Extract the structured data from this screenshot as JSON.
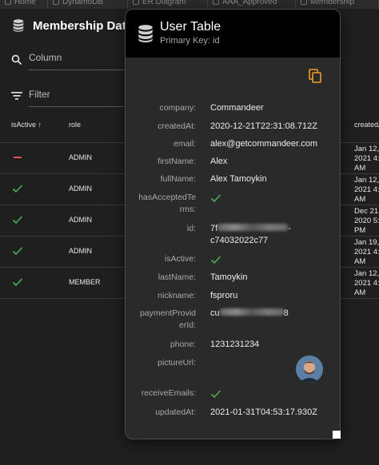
{
  "tabs": [
    {
      "label": "Home"
    },
    {
      "label": "DynamoDB"
    },
    {
      "label": "ER Diagram"
    },
    {
      "label": "AAA_Approved"
    },
    {
      "label": "Membership"
    }
  ],
  "panel": {
    "title": "Membership Data",
    "column_placeholder": "Column",
    "filter_placeholder": "Filter",
    "columns": [
      "isActive",
      "role",
      "createdAt"
    ],
    "sort_indicator": "↑",
    "rows": [
      {
        "active": "dash",
        "role": "ADMIN",
        "created": "Jan 12, 2021 4:... AM"
      },
      {
        "active": "check",
        "role": "ADMIN",
        "created": "Jan 12, 2021 4:... AM"
      },
      {
        "active": "check",
        "role": "ADMIN",
        "created": "Dec 21, 2020 5:... PM"
      },
      {
        "active": "check",
        "role": "ADMIN",
        "created": "Jan 19, 2021 4:... AM"
      },
      {
        "active": "check",
        "role": "MEMBER",
        "created": "Jan 12, 2021 4:... AM"
      }
    ]
  },
  "card": {
    "title": "User Table",
    "subtitle": "Primary Key: id",
    "fields": [
      {
        "key": "company:",
        "value": "Commandeer"
      },
      {
        "key": "createdAt:",
        "value": "2020-12-21T22:31:08.712Z"
      },
      {
        "key": "email:",
        "value": "alex@getcommandeer.com"
      },
      {
        "key": "firstName:",
        "value": "Alex"
      },
      {
        "key": "fullName:",
        "value": "Alex Tamoykin"
      },
      {
        "key_line1": "hasAcceptedTe",
        "key_line2": "rms:",
        "value_icon": "check-icon"
      },
      {
        "key": "id:",
        "value_line1_prefix": "7f",
        "value_line1_suffix": "-",
        "value_line2": "c74032022c77"
      },
      {
        "key": "isActive:",
        "value_icon": "check-icon"
      },
      {
        "key": "lastName:",
        "value": "Tamoykin"
      },
      {
        "key": "nickname:",
        "value": "fsproru"
      },
      {
        "key_line1": "paymentProvid",
        "key_line2": "erId:",
        "value_prefix": "cu",
        "value_suffix": "8"
      },
      {
        "key": "phone:",
        "value": "1231231234"
      },
      {
        "key": "pictureUrl:",
        "value_icon": "avatar"
      },
      {
        "key": "receiveEmails:",
        "value_icon": "check-icon"
      },
      {
        "key": "updatedAt:",
        "value": "2021-01-31T04:53:17.930Z"
      }
    ]
  },
  "colors": {
    "background": "#1f1f1f",
    "card_bg": "#2a2a2a",
    "header_bg": "#000000",
    "check_green": "#4caf50",
    "dash_red": "#e05555",
    "copy_orange": "#f0a020"
  }
}
